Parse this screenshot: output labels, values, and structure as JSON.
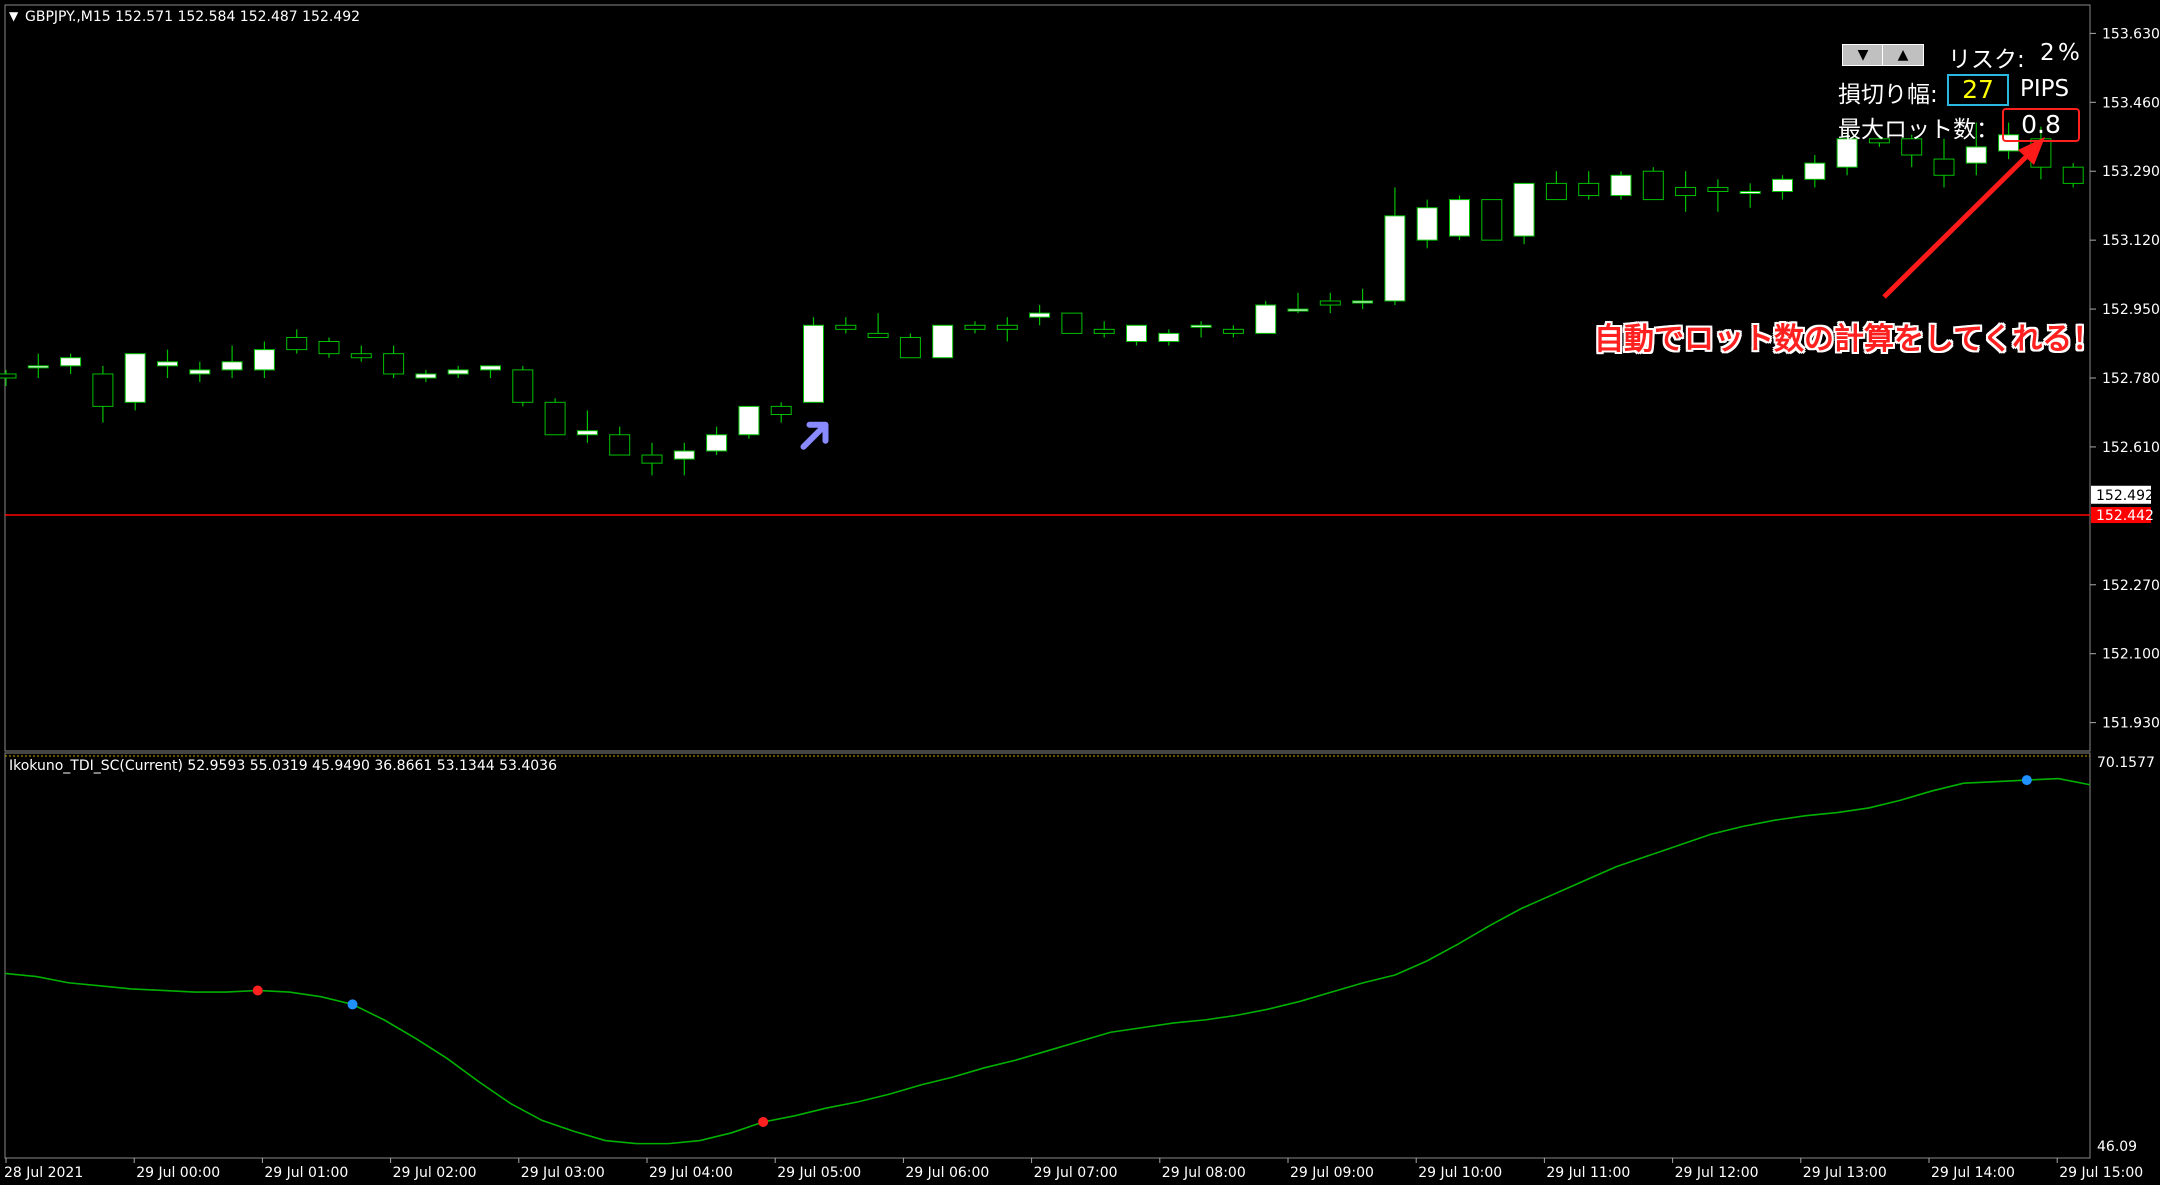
{
  "chart_window": {
    "header": "GBPJPY.,M15  152.571 152.584 152.487 152.492",
    "colors": {
      "background": "#000000",
      "bull": "#ffffff",
      "outline": "#00c000",
      "wick": "#00c000",
      "bid_line": "#ff0000",
      "indicator": "#00b000"
    }
  },
  "risk_panel": {
    "down_arrow": "▼",
    "up_arrow": "▲",
    "risk_label": "リスク:",
    "risk_value": "2",
    "risk_unit": "%",
    "stoploss_label": "損切り幅:",
    "stoploss_value": "27",
    "stoploss_unit": "PIPS",
    "maxlot_label": "最大ロット数：",
    "maxlot_value": "0.8"
  },
  "annotation": {
    "text": "自動でロット数の計算をしてくれる！"
  },
  "chart_data": [
    {
      "type": "candlestick",
      "title": "GBPJPY.,M15  152.571 152.584 152.487 152.492",
      "y_ticks": [
        "153.630",
        "153.460",
        "153.290",
        "153.120",
        "152.950",
        "152.780",
        "152.610",
        "152.270",
        "152.100",
        "151.930"
      ],
      "y_range": [
        151.86,
        153.7
      ],
      "current_price_label": "152.492",
      "bid_line_value": 152.442,
      "bid_line_label": "152.442",
      "signal_arrow": {
        "bar_index": 25,
        "price": 152.64
      },
      "candles": [
        [
          152.79,
          152.8,
          152.76,
          152.78
        ],
        [
          152.81,
          152.84,
          152.78,
          152.81
        ],
        [
          152.81,
          152.84,
          152.79,
          152.83
        ],
        [
          152.79,
          152.81,
          152.67,
          152.71
        ],
        [
          152.72,
          152.83,
          152.7,
          152.84
        ],
        [
          152.81,
          152.85,
          152.78,
          152.82
        ],
        [
          152.79,
          152.82,
          152.77,
          152.8
        ],
        [
          152.8,
          152.86,
          152.78,
          152.82
        ],
        [
          152.8,
          152.87,
          152.78,
          152.85
        ],
        [
          152.88,
          152.9,
          152.84,
          152.85
        ],
        [
          152.87,
          152.88,
          152.83,
          152.84
        ],
        [
          152.84,
          152.86,
          152.82,
          152.83
        ],
        [
          152.84,
          152.86,
          152.78,
          152.79
        ],
        [
          152.78,
          152.8,
          152.77,
          152.79
        ],
        [
          152.79,
          152.81,
          152.78,
          152.8
        ],
        [
          152.8,
          152.81,
          152.78,
          152.81
        ],
        [
          152.8,
          152.81,
          152.71,
          152.72
        ],
        [
          152.72,
          152.73,
          152.64,
          152.64
        ],
        [
          152.64,
          152.7,
          152.62,
          152.65
        ],
        [
          152.64,
          152.66,
          152.59,
          152.59
        ],
        [
          152.59,
          152.62,
          152.54,
          152.57
        ],
        [
          152.58,
          152.62,
          152.54,
          152.6
        ],
        [
          152.6,
          152.66,
          152.59,
          152.64
        ],
        [
          152.64,
          152.71,
          152.63,
          152.71
        ],
        [
          152.71,
          152.72,
          152.67,
          152.69
        ],
        [
          152.72,
          152.93,
          152.72,
          152.91
        ],
        [
          152.91,
          152.93,
          152.89,
          152.9
        ],
        [
          152.89,
          152.94,
          152.88,
          152.88
        ],
        [
          152.88,
          152.89,
          152.83,
          152.83
        ],
        [
          152.83,
          152.91,
          152.83,
          152.91
        ],
        [
          152.91,
          152.92,
          152.89,
          152.9
        ],
        [
          152.91,
          152.93,
          152.87,
          152.9
        ],
        [
          152.93,
          152.96,
          152.91,
          152.94
        ],
        [
          152.94,
          152.94,
          152.89,
          152.89
        ],
        [
          152.9,
          152.92,
          152.88,
          152.89
        ],
        [
          152.87,
          152.91,
          152.86,
          152.91
        ],
        [
          152.87,
          152.9,
          152.86,
          152.89
        ],
        [
          152.91,
          152.92,
          152.88,
          152.91
        ],
        [
          152.9,
          152.91,
          152.88,
          152.89
        ],
        [
          152.89,
          152.97,
          152.89,
          152.96
        ],
        [
          152.95,
          152.99,
          152.94,
          152.95
        ],
        [
          152.97,
          152.99,
          152.94,
          152.96
        ],
        [
          152.97,
          153.0,
          152.95,
          152.97
        ],
        [
          152.97,
          153.25,
          152.96,
          153.18
        ],
        [
          153.12,
          153.22,
          153.1,
          153.2
        ],
        [
          153.13,
          153.23,
          153.12,
          153.22
        ],
        [
          153.22,
          153.22,
          153.12,
          153.12
        ],
        [
          153.13,
          153.25,
          153.11,
          153.26
        ],
        [
          153.26,
          153.29,
          153.22,
          153.22
        ],
        [
          153.26,
          153.29,
          153.22,
          153.23
        ],
        [
          153.23,
          153.29,
          153.22,
          153.28
        ],
        [
          153.29,
          153.3,
          153.22,
          153.22
        ],
        [
          153.25,
          153.29,
          153.19,
          153.23
        ],
        [
          153.25,
          153.27,
          153.19,
          153.24
        ],
        [
          153.24,
          153.26,
          153.2,
          153.24
        ],
        [
          153.24,
          153.28,
          153.22,
          153.27
        ],
        [
          153.27,
          153.33,
          153.25,
          153.31
        ],
        [
          153.3,
          153.38,
          153.28,
          153.37
        ],
        [
          153.37,
          153.38,
          153.35,
          153.36
        ],
        [
          153.37,
          153.38,
          153.3,
          153.33
        ],
        [
          153.32,
          153.37,
          153.25,
          153.28
        ],
        [
          153.31,
          153.41,
          153.28,
          153.35
        ],
        [
          153.34,
          153.41,
          153.32,
          153.38
        ],
        [
          153.37,
          153.4,
          153.27,
          153.3
        ],
        [
          153.3,
          153.31,
          153.25,
          153.26
        ]
      ]
    },
    {
      "type": "line",
      "title": "Ikokuno_TDI_SC(Current) 52.9593 55.0319 45.9490 36.8661 53.1344 53.4036",
      "y_ticks": [
        "70.1577",
        "46.09"
      ],
      "values": [
        62.0,
        61.8,
        61.4,
        61.2,
        61.0,
        60.9,
        60.8,
        60.8,
        60.9,
        60.8,
        60.5,
        60.0,
        59.0,
        57.8,
        56.5,
        55.0,
        53.6,
        52.5,
        51.8,
        51.2,
        51.0,
        51.0,
        51.2,
        51.7,
        52.4,
        52.8,
        53.3,
        53.7,
        54.2,
        54.8,
        55.3,
        55.9,
        56.4,
        57.0,
        57.6,
        58.2,
        58.5,
        58.8,
        59.0,
        59.3,
        59.7,
        60.2,
        60.8,
        61.4,
        61.9,
        62.8,
        63.9,
        65.1,
        66.2,
        67.1,
        68.0,
        68.9,
        69.6,
        70.3,
        71.0,
        71.5,
        71.9,
        72.2,
        72.4,
        72.7,
        73.2,
        73.8,
        74.3,
        74.4,
        74.5,
        74.6,
        74.2
      ],
      "markers": [
        {
          "index": 8,
          "color": "#ff2020"
        },
        {
          "index": 11,
          "color": "#2090ff"
        },
        {
          "index": 24,
          "color": "#ff2020"
        },
        {
          "index": 64,
          "color": "#2090ff"
        }
      ],
      "y_range": [
        50.2,
        75.8
      ]
    }
  ],
  "x_axis_labels": [
    "28 Jul 2021",
    "29 Jul 00:00",
    "29 Jul 01:00",
    "29 Jul 02:00",
    "29 Jul 03:00",
    "29 Jul 04:00",
    "29 Jul 05:00",
    "29 Jul 06:00",
    "29 Jul 07:00",
    "29 Jul 08:00",
    "29 Jul 09:00",
    "29 Jul 10:00",
    "29 Jul 11:00",
    "29 Jul 12:00",
    "29 Jul 13:00",
    "29 Jul 14:00",
    "29 Jul 15:00"
  ]
}
